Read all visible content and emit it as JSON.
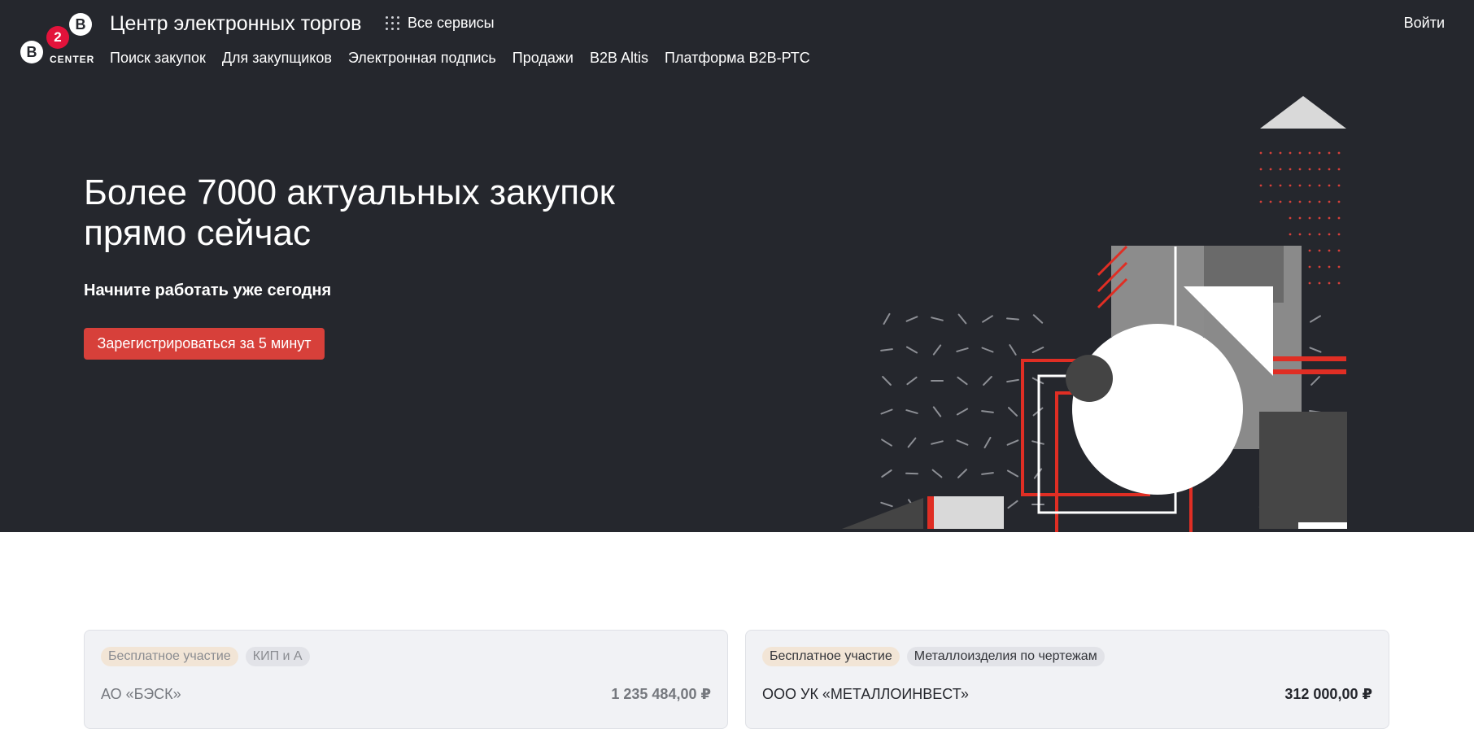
{
  "header": {
    "logo": {
      "letter_top": "B",
      "number": "2",
      "letter_left": "B",
      "word": "CENTER"
    },
    "title": "Центр электронных торгов",
    "all_services": "Все сервисы",
    "login": "Войти"
  },
  "nav": {
    "items": [
      "Поиск закупок",
      "Для закупщиков",
      "Электронная подпись",
      "Продажи",
      "B2B Altis",
      "Платформа B2B-РТС"
    ]
  },
  "hero": {
    "headline": "Более 7000 актуальных закупок прямо сейчас",
    "subhead": "Начните работать уже сегодня",
    "cta": "Зарегистрироваться за 5 минут"
  },
  "cards": [
    {
      "tags": [
        "Бесплатное участие",
        "КИП и А"
      ],
      "company": "АО «БЭСК»",
      "price": "1 235 484,00 ₽"
    },
    {
      "tags": [
        "Бесплатное участие",
        "Металлоизделия по чертежам"
      ],
      "company": "ООО УК «МЕТАЛЛОИНВЕСТ»",
      "price": "312 000,00 ₽"
    }
  ],
  "colors": {
    "hero_bg": "#25272d",
    "accent_red": "#d7403a",
    "logo_red": "#e3133b",
    "card_bg": "#f1f2f5"
  },
  "icons": {
    "services": "grid-dots-icon",
    "illustration": "geometric-illustration"
  }
}
